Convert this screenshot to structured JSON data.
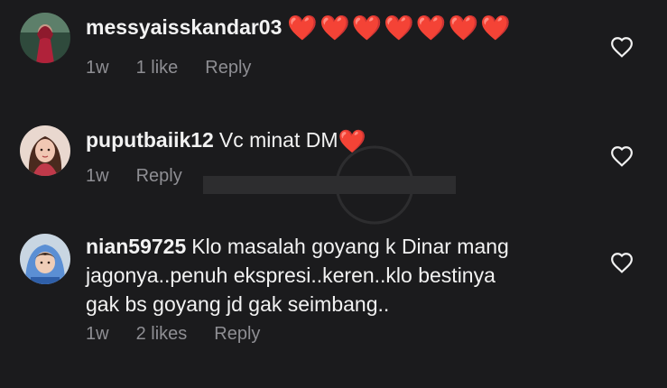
{
  "comments": [
    {
      "username": "messyaisskandar03",
      "text": "",
      "emoji": "❤️❤️❤️❤️❤️❤️❤️",
      "time": "1w",
      "likes": "1 like",
      "reply": "Reply",
      "like_icon": "heart-outline-icon"
    },
    {
      "username": "puputbaiik12",
      "text": "Vc minat DM",
      "emoji": "❤️",
      "time": "1w",
      "likes": "",
      "reply": "Reply",
      "like_icon": "heart-outline-icon"
    },
    {
      "username": "nian59725",
      "text_lines": [
        "Klo masalah goyang k Dinar mang",
        "jagonya..penuh ekspresi..keren..klo bestinya",
        "gak bs goyang jd gak seimbang.."
      ],
      "time": "1w",
      "likes": "2 likes",
      "reply": "Reply",
      "like_icon": "heart-outline-icon"
    }
  ],
  "colors": {
    "background": "#1b1b1d",
    "text": "#f2f2f2",
    "meta": "#8e8e93",
    "heart": "#e8212f"
  }
}
